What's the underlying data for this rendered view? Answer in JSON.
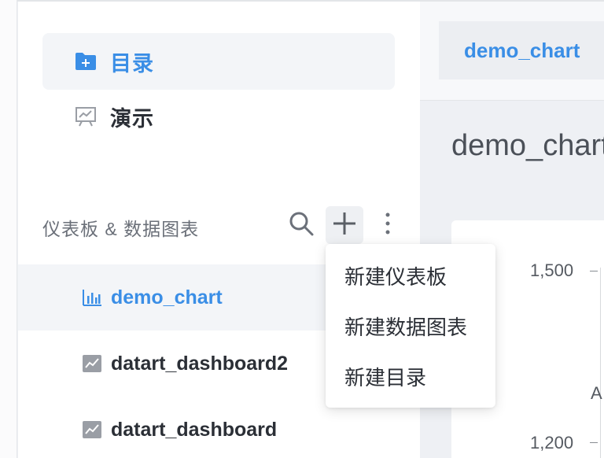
{
  "nav": {
    "catalog_label": "目录",
    "presentation_label": "演示"
  },
  "section": {
    "title": "仪表板 & 数据图表",
    "actions": [
      "search-icon",
      "plus-icon",
      "more-vertical-icon"
    ]
  },
  "tree": {
    "items": [
      {
        "label": "demo_chart",
        "icon": "bar-chart-icon",
        "selected": true
      },
      {
        "label": "datart_dashboard2",
        "icon": "line-chart-icon",
        "selected": false
      },
      {
        "label": "datart_dashboard",
        "icon": "line-chart-icon",
        "selected": false
      }
    ]
  },
  "dropdown": {
    "items": [
      "新建仪表板",
      "新建数据图表",
      "新建目录"
    ]
  },
  "main": {
    "tab_label": "demo_chart",
    "page_title": "demo_chart",
    "chart": {
      "y_ticks": [
        "1,500",
        "1,200"
      ],
      "partial_label": "A"
    }
  },
  "colors": {
    "accent": "#3a8ee6",
    "sidebar_bg": "#ffffff",
    "main_bg": "#eef0f4",
    "selected_bg": "#f3f5f8"
  }
}
